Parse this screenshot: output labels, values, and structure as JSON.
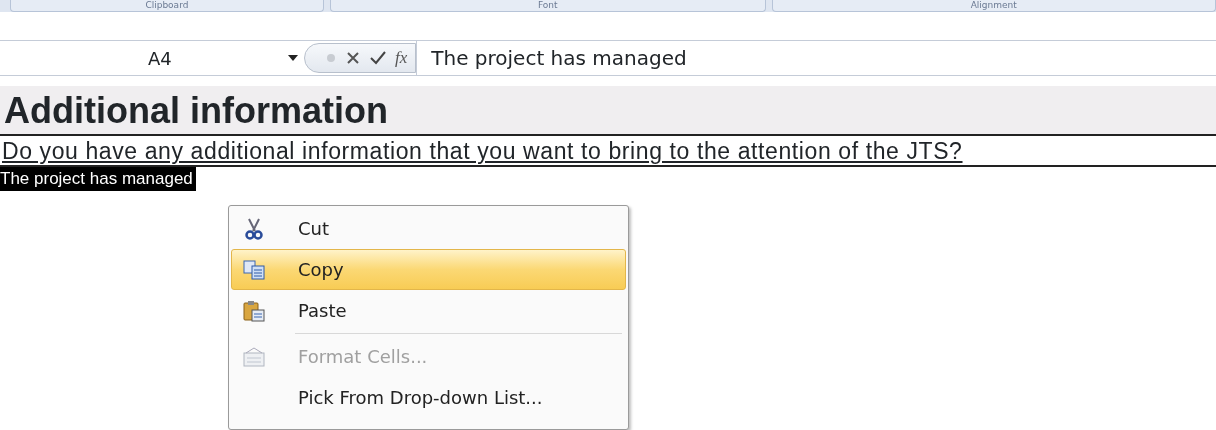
{
  "ribbon_groups": [
    {
      "label": "Clipboard"
    },
    {
      "label": "Font"
    },
    {
      "label": "Alignment"
    }
  ],
  "formula_bar": {
    "name_box": "A4",
    "function_button": "fx",
    "value": "The project has managed"
  },
  "sheet": {
    "heading": "Additional information",
    "question": "Do you have any additional information that you want to bring to the attention of the JTS?",
    "answer": {
      "text": "The project has managed",
      "selected": true
    }
  },
  "context_menu": {
    "items": [
      {
        "kind": "item",
        "label": "Cut",
        "selected": false,
        "disabled": false
      },
      {
        "kind": "item",
        "label": "Copy",
        "selected": true,
        "disabled": false
      },
      {
        "kind": "item",
        "label": "Paste",
        "selected": false,
        "disabled": false
      },
      {
        "kind": "separator"
      },
      {
        "kind": "item",
        "label": "Format Cells...",
        "selected": false,
        "disabled": true
      },
      {
        "kind": "item",
        "label": "Pick From Drop-down List...",
        "selected": false,
        "disabled": false
      }
    ]
  }
}
